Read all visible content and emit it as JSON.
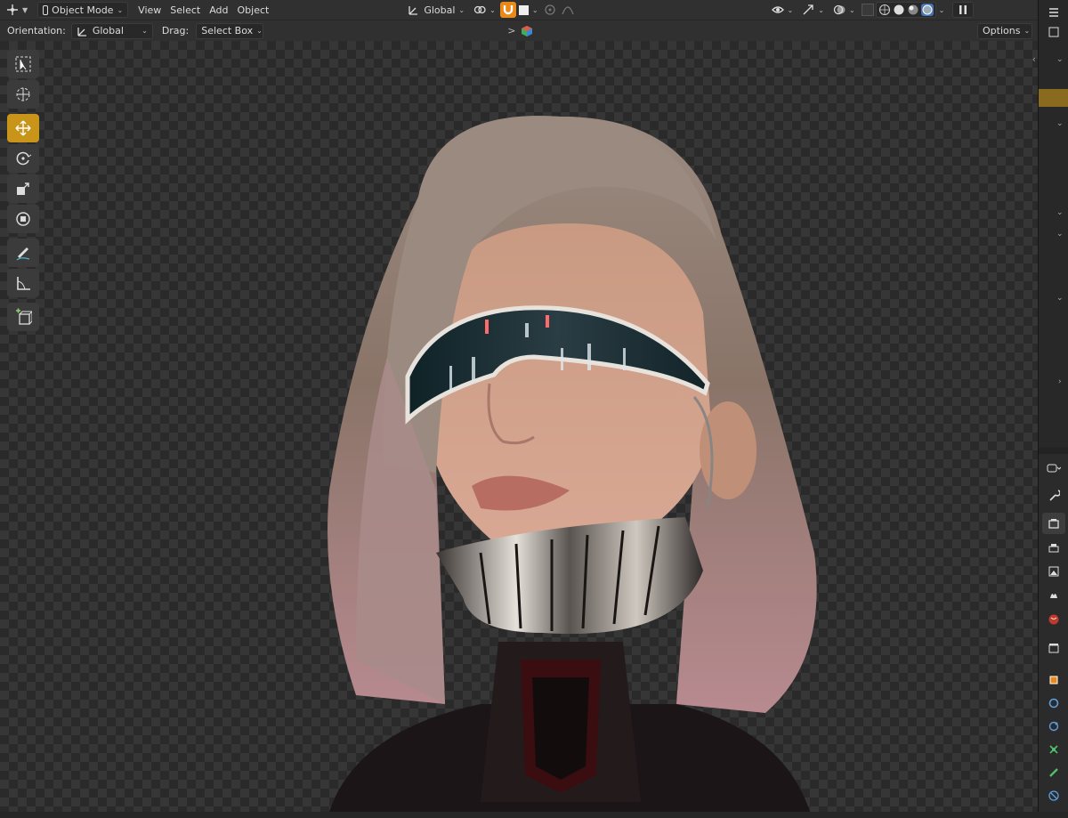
{
  "header": {
    "mode": "Object Mode",
    "menus": [
      "View",
      "Select",
      "Add",
      "Object"
    ],
    "transform_orientation": "Global"
  },
  "tool_settings": {
    "orientation_label": "Orientation:",
    "orientation_value": "Global",
    "drag_label": "Drag:",
    "drag_value": "Select Box",
    "options_label": "Options",
    "expand_arrow": ">"
  },
  "toolbar": {
    "tools": [
      "select-box",
      "cursor",
      "move",
      "rotate",
      "scale",
      "transform",
      "annotate",
      "measure",
      "add-cube"
    ],
    "active_tool": "move"
  },
  "icons": {
    "editor_type": "transform-gizmo-icon",
    "pivot": "pivot-icon",
    "snap": "magnet-icon",
    "overlays": "overlays-icon",
    "shading_modes": [
      "wireframe",
      "solid",
      "material-preview",
      "rendered"
    ],
    "active_shading": "rendered"
  },
  "colors": {
    "accent_orange": "#e8891a",
    "active_tool": "#c9941a",
    "header_bg": "#303030",
    "shading_active": "#4772b3"
  }
}
